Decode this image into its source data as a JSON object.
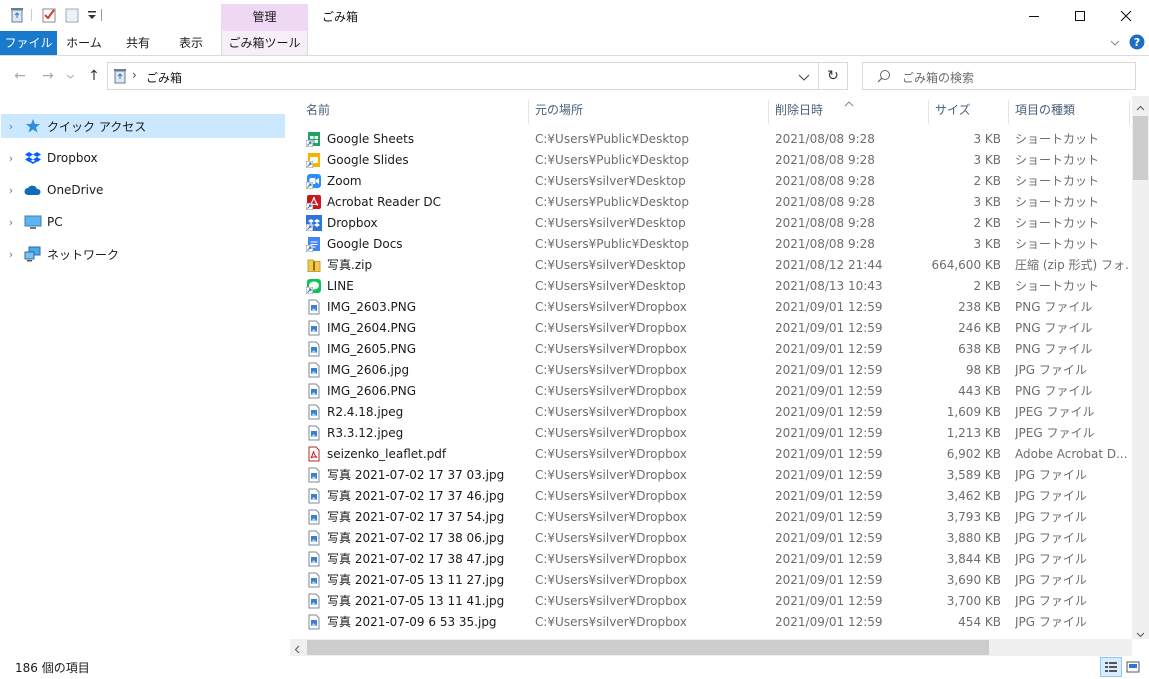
{
  "window": {
    "title": "ごみ箱",
    "context_tab": "管理",
    "minimize_glyph": "—",
    "maximize_glyph": "☐",
    "close_glyph": "✕"
  },
  "ribbon": {
    "tabs": [
      "ファイル",
      "ホーム",
      "共有",
      "表示",
      "ごみ箱ツール"
    ]
  },
  "address": {
    "back_glyph": "←",
    "forward_glyph": "→",
    "up_glyph": "↑",
    "separator": "›",
    "current": "ごみ箱",
    "refresh_glyph": "↻",
    "search_placeholder": "ごみ箱の検索"
  },
  "nav": {
    "items": [
      {
        "label": "クイック アクセス",
        "icon": "star-icon",
        "selected": true
      },
      {
        "label": "Dropbox",
        "icon": "dropbox-icon",
        "selected": false
      },
      {
        "label": "OneDrive",
        "icon": "onedrive-cloud-icon",
        "selected": false
      },
      {
        "label": "PC",
        "icon": "pc-monitor-icon",
        "selected": false
      },
      {
        "label": "ネットワーク",
        "icon": "network-icon",
        "selected": false
      }
    ]
  },
  "columns": {
    "name": "名前",
    "location": "元の場所",
    "deleted": "削除日時",
    "size": "サイズ",
    "type": "項目の種類"
  },
  "files": [
    {
      "name": "Google Sheets",
      "loc": "C:¥Users¥Public¥Desktop",
      "date": "2021/08/08 9:28",
      "size": "3 KB",
      "type": "ショートカット",
      "icon": "sheets"
    },
    {
      "name": "Google Slides",
      "loc": "C:¥Users¥Public¥Desktop",
      "date": "2021/08/08 9:28",
      "size": "3 KB",
      "type": "ショートカット",
      "icon": "slides"
    },
    {
      "name": "Zoom",
      "loc": "C:¥Users¥silver¥Desktop",
      "date": "2021/08/08 9:28",
      "size": "2 KB",
      "type": "ショートカット",
      "icon": "zoom"
    },
    {
      "name": "Acrobat Reader DC",
      "loc": "C:¥Users¥Public¥Desktop",
      "date": "2021/08/08 9:28",
      "size": "3 KB",
      "type": "ショートカット",
      "icon": "acrobat"
    },
    {
      "name": "Dropbox",
      "loc": "C:¥Users¥silver¥Desktop",
      "date": "2021/08/08 9:28",
      "size": "2 KB",
      "type": "ショートカット",
      "icon": "dropbox"
    },
    {
      "name": "Google Docs",
      "loc": "C:¥Users¥Public¥Desktop",
      "date": "2021/08/08 9:28",
      "size": "3 KB",
      "type": "ショートカット",
      "icon": "docs"
    },
    {
      "name": "写真.zip",
      "loc": "C:¥Users¥silver¥Desktop",
      "date": "2021/08/12 21:44",
      "size": "664,600 KB",
      "type": "圧縮 (zip 形式) フォ...",
      "icon": "zip"
    },
    {
      "name": "LINE",
      "loc": "C:¥Users¥silver¥Desktop",
      "date": "2021/08/13 10:43",
      "size": "2 KB",
      "type": "ショートカット",
      "icon": "line"
    },
    {
      "name": "IMG_2603.PNG",
      "loc": "C:¥Users¥silver¥Dropbox",
      "date": "2021/09/01 12:59",
      "size": "238 KB",
      "type": "PNG ファイル",
      "icon": "image"
    },
    {
      "name": "IMG_2604.PNG",
      "loc": "C:¥Users¥silver¥Dropbox",
      "date": "2021/09/01 12:59",
      "size": "246 KB",
      "type": "PNG ファイル",
      "icon": "image"
    },
    {
      "name": "IMG_2605.PNG",
      "loc": "C:¥Users¥silver¥Dropbox",
      "date": "2021/09/01 12:59",
      "size": "638 KB",
      "type": "PNG ファイル",
      "icon": "image"
    },
    {
      "name": "IMG_2606.jpg",
      "loc": "C:¥Users¥silver¥Dropbox",
      "date": "2021/09/01 12:59",
      "size": "98 KB",
      "type": "JPG ファイル",
      "icon": "image"
    },
    {
      "name": "IMG_2606.PNG",
      "loc": "C:¥Users¥silver¥Dropbox",
      "date": "2021/09/01 12:59",
      "size": "443 KB",
      "type": "PNG ファイル",
      "icon": "image"
    },
    {
      "name": "R2.4.18.jpeg",
      "loc": "C:¥Users¥silver¥Dropbox",
      "date": "2021/09/01 12:59",
      "size": "1,609 KB",
      "type": "JPEG ファイル",
      "icon": "image"
    },
    {
      "name": "R3.3.12.jpeg",
      "loc": "C:¥Users¥silver¥Dropbox",
      "date": "2021/09/01 12:59",
      "size": "1,213 KB",
      "type": "JPEG ファイル",
      "icon": "image"
    },
    {
      "name": "seizenko_leaflet.pdf",
      "loc": "C:¥Users¥silver¥Dropbox",
      "date": "2021/09/01 12:59",
      "size": "6,902 KB",
      "type": "Adobe Acrobat D...",
      "icon": "pdf"
    },
    {
      "name": "写真 2021-07-02 17 37 03.jpg",
      "loc": "C:¥Users¥silver¥Dropbox",
      "date": "2021/09/01 12:59",
      "size": "3,589 KB",
      "type": "JPG ファイル",
      "icon": "image"
    },
    {
      "name": "写真 2021-07-02 17 37 46.jpg",
      "loc": "C:¥Users¥silver¥Dropbox",
      "date": "2021/09/01 12:59",
      "size": "3,462 KB",
      "type": "JPG ファイル",
      "icon": "image"
    },
    {
      "name": "写真 2021-07-02 17 37 54.jpg",
      "loc": "C:¥Users¥silver¥Dropbox",
      "date": "2021/09/01 12:59",
      "size": "3,793 KB",
      "type": "JPG ファイル",
      "icon": "image"
    },
    {
      "name": "写真 2021-07-02 17 38 06.jpg",
      "loc": "C:¥Users¥silver¥Dropbox",
      "date": "2021/09/01 12:59",
      "size": "3,880 KB",
      "type": "JPG ファイル",
      "icon": "image"
    },
    {
      "name": "写真 2021-07-02 17 38 47.jpg",
      "loc": "C:¥Users¥silver¥Dropbox",
      "date": "2021/09/01 12:59",
      "size": "3,844 KB",
      "type": "JPG ファイル",
      "icon": "image"
    },
    {
      "name": "写真 2021-07-05 13 11 27.jpg",
      "loc": "C:¥Users¥silver¥Dropbox",
      "date": "2021/09/01 12:59",
      "size": "3,690 KB",
      "type": "JPG ファイル",
      "icon": "image"
    },
    {
      "name": "写真 2021-07-05 13 11 41.jpg",
      "loc": "C:¥Users¥silver¥Dropbox",
      "date": "2021/09/01 12:59",
      "size": "3,700 KB",
      "type": "JPG ファイル",
      "icon": "image"
    },
    {
      "name": "写真 2021-07-09 6 53 35.jpg",
      "loc": "C:¥Users¥silver¥Dropbox",
      "date": "2021/09/01 12:59",
      "size": "454 KB",
      "type": "JPG ファイル",
      "icon": "image"
    }
  ],
  "status": {
    "item_count": "186 個の項目"
  },
  "colors": {
    "accent": "#1979ca",
    "selection": "#cce8ff",
    "context_tab": "#efd8f4"
  }
}
